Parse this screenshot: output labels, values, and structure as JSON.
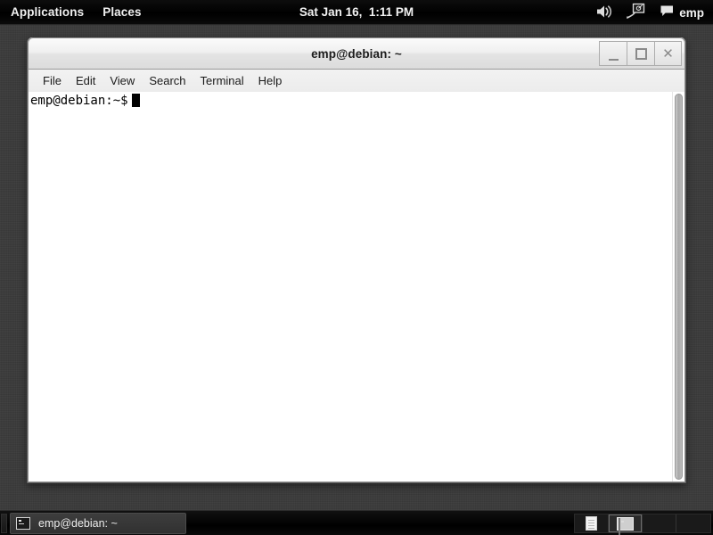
{
  "top_panel": {
    "menus": [
      {
        "label": "Applications",
        "name": "applications-menu"
      },
      {
        "label": "Places",
        "name": "places-menu"
      }
    ],
    "clock": "Sat Jan 16,  1:11 PM",
    "tray": {
      "volume_icon": "speaker-volume-icon",
      "network_icon": "network-wired-icon",
      "chat_icon": "chat-bubble-icon",
      "user_name": "emp"
    }
  },
  "window": {
    "title": "emp@debian: ~",
    "controls": {
      "minimize": "minimize-button",
      "maximize": "maximize-button",
      "close": "close-button"
    },
    "menubar": [
      {
        "label": "File",
        "name": "menu-file"
      },
      {
        "label": "Edit",
        "name": "menu-edit"
      },
      {
        "label": "View",
        "name": "menu-view"
      },
      {
        "label": "Search",
        "name": "menu-search"
      },
      {
        "label": "Terminal",
        "name": "menu-terminal"
      },
      {
        "label": "Help",
        "name": "menu-help"
      }
    ],
    "terminal": {
      "prompt": "emp@debian:~$",
      "command": ""
    }
  },
  "bottom_panel": {
    "tasks": [
      {
        "label": "emp@debian: ~",
        "icon": "terminal-icon",
        "active": true
      }
    ],
    "workspaces": [
      {
        "index": 1,
        "active": false,
        "content": "document"
      },
      {
        "index": 2,
        "active": true,
        "content": "terminal"
      },
      {
        "index": 3,
        "active": false,
        "content": "empty"
      },
      {
        "index": 4,
        "active": false,
        "content": "empty"
      }
    ]
  }
}
